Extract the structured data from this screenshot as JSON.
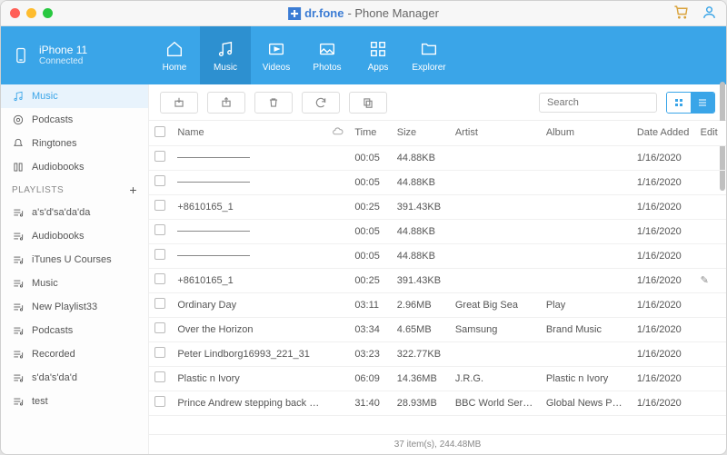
{
  "app": {
    "brand": "dr.fone",
    "subtitle": "- Phone Manager"
  },
  "device": {
    "name": "iPhone 11",
    "status": "Connected"
  },
  "nav": [
    {
      "label": "Home",
      "icon": "home"
    },
    {
      "label": "Music",
      "icon": "music",
      "active": true
    },
    {
      "label": "Videos",
      "icon": "video"
    },
    {
      "label": "Photos",
      "icon": "photo"
    },
    {
      "label": "Apps",
      "icon": "apps"
    },
    {
      "label": "Explorer",
      "icon": "explorer"
    }
  ],
  "sidebar": {
    "items": [
      {
        "label": "Music",
        "active": true
      },
      {
        "label": "Podcasts"
      },
      {
        "label": "Ringtones"
      },
      {
        "label": "Audiobooks"
      }
    ],
    "playlists_header": "PLAYLISTS",
    "playlists": [
      {
        "label": "a's'd'sa'da'da"
      },
      {
        "label": "Audiobooks"
      },
      {
        "label": "iTunes U Courses"
      },
      {
        "label": "Music"
      },
      {
        "label": "New Playlist33"
      },
      {
        "label": "Podcasts"
      },
      {
        "label": "Recorded"
      },
      {
        "label": "s'da's'da'd"
      },
      {
        "label": "test"
      }
    ]
  },
  "search_placeholder": "Search",
  "columns": {
    "name": "Name",
    "time": "Time",
    "size": "Size",
    "artist": "Artist",
    "album": "Album",
    "date": "Date Added",
    "edit": "Edit"
  },
  "tracks": [
    {
      "name": "",
      "placeholder": true,
      "time": "00:05",
      "size": "44.88KB",
      "artist": "",
      "album": "",
      "date": "1/16/2020"
    },
    {
      "name": "",
      "placeholder": true,
      "time": "00:05",
      "size": "44.88KB",
      "artist": "",
      "album": "",
      "date": "1/16/2020"
    },
    {
      "name": "+8610165_1",
      "time": "00:25",
      "size": "391.43KB",
      "artist": "",
      "album": "",
      "date": "1/16/2020"
    },
    {
      "name": "",
      "placeholder": true,
      "time": "00:05",
      "size": "44.88KB",
      "artist": "",
      "album": "",
      "date": "1/16/2020"
    },
    {
      "name": "",
      "placeholder": true,
      "time": "00:05",
      "size": "44.88KB",
      "artist": "",
      "album": "",
      "date": "1/16/2020"
    },
    {
      "name": "+8610165_1",
      "time": "00:25",
      "size": "391.43KB",
      "artist": "",
      "album": "",
      "date": "1/16/2020",
      "edit": true
    },
    {
      "name": "Ordinary Day",
      "time": "03:11",
      "size": "2.96MB",
      "artist": "Great Big Sea",
      "album": "Play",
      "date": "1/16/2020"
    },
    {
      "name": "Over the Horizon",
      "time": "03:34",
      "size": "4.65MB",
      "artist": "Samsung",
      "album": "Brand Music",
      "date": "1/16/2020"
    },
    {
      "name": "Peter Lindborg16993_221_31",
      "time": "03:23",
      "size": "322.77KB",
      "artist": "",
      "album": "",
      "date": "1/16/2020"
    },
    {
      "name": "Plastic n Ivory",
      "time": "06:09",
      "size": "14.36MB",
      "artist": "J.R.G.",
      "album": "Plastic n Ivory",
      "date": "1/16/2020"
    },
    {
      "name": "Prince Andrew stepping back fro...",
      "time": "31:40",
      "size": "28.93MB",
      "artist": "BBC World Service",
      "album": "Global News Podc...",
      "date": "1/16/2020"
    }
  ],
  "status": "37 item(s), 244.48MB"
}
